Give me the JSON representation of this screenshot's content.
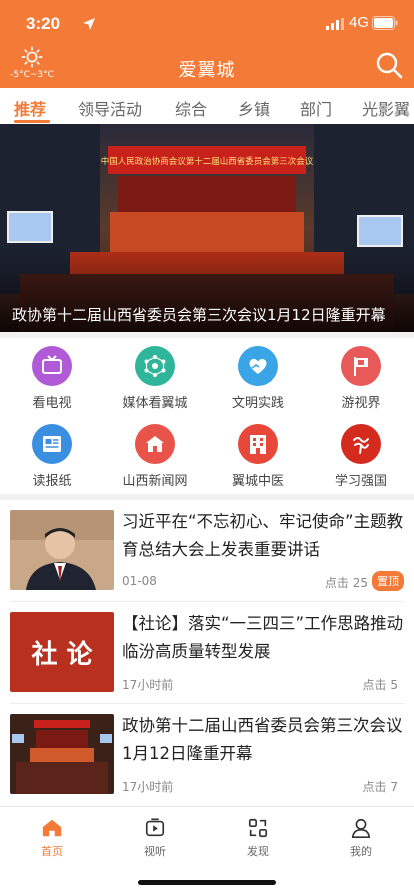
{
  "status_bar": {
    "time": "3:20",
    "network": "4G"
  },
  "header": {
    "title": "爱翼城",
    "weather": {
      "temperature": "-5°C~3°C",
      "icon": "sun-icon"
    },
    "search_icon": "search-icon"
  },
  "tabs": [
    {
      "label": "推荐",
      "active": true
    },
    {
      "label": "领导活动"
    },
    {
      "label": "综合"
    },
    {
      "label": "乡镇"
    },
    {
      "label": "部门"
    },
    {
      "label": "光影翼"
    }
  ],
  "banner": {
    "caption": "政协第十二届山西省委员会第三次会议1月12日隆重开幕",
    "stage_banner_text": "中国人民政治协商会议第十二届山西省委员会第三次会议"
  },
  "shortcuts": [
    {
      "label": "看电视",
      "color": "#b05ad8",
      "icon": "tv-icon"
    },
    {
      "label": "媒体看翼城",
      "color": "#2fb59a",
      "icon": "network-icon"
    },
    {
      "label": "文明实践",
      "color": "#3aa5e6",
      "icon": "heart-hands-icon"
    },
    {
      "label": "游视界",
      "color": "#e85a5a",
      "icon": "flag-icon"
    },
    {
      "label": "读报纸",
      "color": "#3a8fe0",
      "icon": "newspaper-icon"
    },
    {
      "label": "山西新闻网",
      "color": "#e8534a",
      "icon": "building-icon"
    },
    {
      "label": "翼城中医",
      "color": "#e8483a",
      "icon": "hospital-icon"
    },
    {
      "label": "学习强国",
      "color": "#d42b1e",
      "icon": "xuexi-logo-icon"
    }
  ],
  "news": [
    {
      "title": "习近平在“不忘初心、牢记使命”主题教育总结大会上发表重要讲话",
      "date": "01-08",
      "views": "点击 25",
      "badge": "置顶"
    },
    {
      "title": "【社论】落实“一三四三”工作思路推动临汾高质量转型发展",
      "date": "17小时前",
      "views": "点击 5",
      "thumb_text": "社 论"
    },
    {
      "title": "政协第十二届山西省委员会第三次会议1月12日隆重开幕",
      "date": "17小时前",
      "views": "点击 7"
    }
  ],
  "bottom_nav": [
    {
      "label": "首页",
      "icon": "home-icon",
      "active": true
    },
    {
      "label": "视听",
      "icon": "video-icon"
    },
    {
      "label": "发现",
      "icon": "discover-icon"
    },
    {
      "label": "我的",
      "icon": "user-icon"
    }
  ],
  "colors": {
    "brand": "#f47a38",
    "pin_badge": "#f47a38"
  }
}
